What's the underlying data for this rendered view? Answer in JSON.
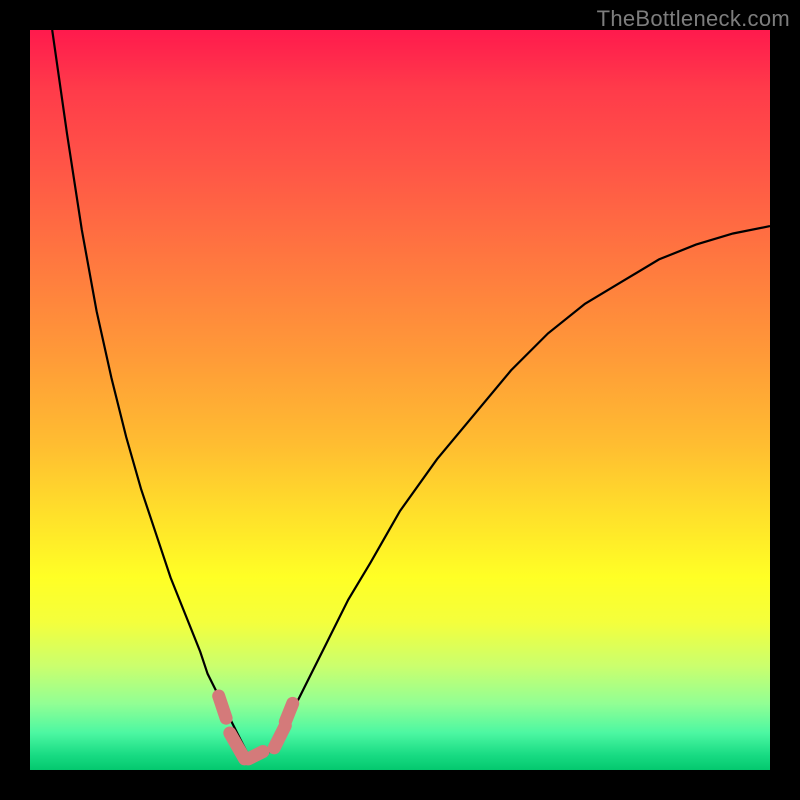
{
  "attribution": "TheBottleneck.com",
  "colors": {
    "frame": "#000000",
    "curve_stroke": "#000000",
    "accent_stroke": "#d47a7a",
    "gradient_top": "#ff1a4d",
    "gradient_bottom": "#04c86e"
  },
  "chart_data": {
    "type": "line",
    "title": "",
    "xlabel": "",
    "ylabel": "",
    "xlim": [
      0,
      100
    ],
    "ylim": [
      0,
      100
    ],
    "grid": false,
    "x": [
      3,
      5,
      7,
      9,
      11,
      13,
      15,
      17,
      19,
      21,
      23,
      24,
      25,
      26,
      27,
      28,
      29,
      29.5,
      30,
      31,
      32,
      33,
      34,
      36,
      38,
      40,
      43,
      46,
      50,
      55,
      60,
      65,
      70,
      75,
      80,
      85,
      90,
      95,
      100
    ],
    "values": [
      100,
      86,
      73,
      62,
      53,
      45,
      38,
      32,
      26,
      21,
      16,
      13,
      11,
      9,
      7,
      5,
      3,
      2,
      1.5,
      1.5,
      2,
      3.5,
      5,
      9,
      13,
      17,
      23,
      28,
      35,
      42,
      48,
      54,
      59,
      63,
      66,
      69,
      71,
      72.5,
      73.5
    ],
    "accent_segments": [
      {
        "x_start": 25.5,
        "x_end": 26.5,
        "y_start": 10,
        "y_end": 7
      },
      {
        "x_start": 27,
        "x_end": 29,
        "y_start": 5,
        "y_end": 1.5
      },
      {
        "x_start": 29.5,
        "x_end": 31.5,
        "y_start": 1.5,
        "y_end": 2.5
      },
      {
        "x_start": 33,
        "x_end": 34.5,
        "y_start": 3,
        "y_end": 6
      },
      {
        "x_start": 34.5,
        "x_end": 35.5,
        "y_start": 6.5,
        "y_end": 9
      }
    ],
    "annotations": []
  }
}
